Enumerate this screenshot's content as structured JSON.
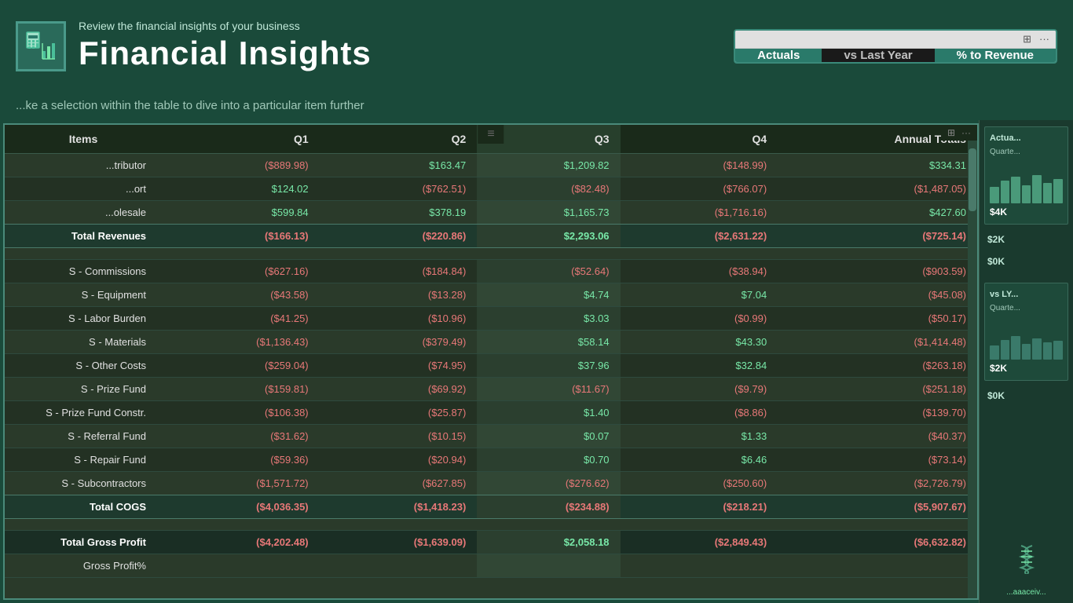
{
  "header": {
    "subtitle": "Review the financial insights of your business",
    "title": "Financial Insights"
  },
  "toggle_panel": {
    "buttons": [
      {
        "label": "Actuals",
        "active": true
      },
      {
        "label": "vs Last Year",
        "active": false
      },
      {
        "label": "% to Revenue",
        "active": false
      }
    ]
  },
  "sub_header_text": "ke a selection within the table to dive into a particular item further",
  "table": {
    "columns": [
      "Items",
      "Q1",
      "Q2",
      "Q3",
      "Q4",
      "Annual Totals"
    ],
    "rows": [
      {
        "type": "data",
        "label": "...tributor",
        "q1": "($889.98)",
        "q2": "$163.47",
        "q3": "$1,209.82",
        "q4": "($148.99)",
        "annual": "$334.31"
      },
      {
        "type": "data",
        "label": "...ort",
        "q1": "$124.02",
        "q2": "($762.51)",
        "q3": "($82.48)",
        "q4": "($766.07)",
        "annual": "($1,487.05)"
      },
      {
        "type": "data",
        "label": "...olesale",
        "q1": "$599.84",
        "q2": "$378.19",
        "q3": "$1,165.73",
        "q4": "($1,716.16)",
        "annual": "$427.60"
      },
      {
        "type": "total",
        "label": "   Total Revenues",
        "q1": "($166.13)",
        "q2": "($220.86)",
        "q3": "$2,293.06",
        "q4": "($2,631.22)",
        "annual": "($725.14)"
      },
      {
        "type": "space"
      },
      {
        "type": "data",
        "label": "S - Commissions",
        "q1": "($627.16)",
        "q2": "($184.84)",
        "q3": "($52.64)",
        "q4": "($38.94)",
        "annual": "($903.59)"
      },
      {
        "type": "data",
        "label": "S - Equipment",
        "q1": "($43.58)",
        "q2": "($13.28)",
        "q3": "$4.74",
        "q4": "$7.04",
        "annual": "($45.08)"
      },
      {
        "type": "data",
        "label": "S - Labor Burden",
        "q1": "($41.25)",
        "q2": "($10.96)",
        "q3": "$3.03",
        "q4": "($0.99)",
        "annual": "($50.17)"
      },
      {
        "type": "data",
        "label": "S - Materials",
        "q1": "($1,136.43)",
        "q2": "($379.49)",
        "q3": "$58.14",
        "q4": "$43.30",
        "annual": "($1,414.48)"
      },
      {
        "type": "data",
        "label": "S - Other Costs",
        "q1": "($259.04)",
        "q2": "($74.95)",
        "q3": "$37.96",
        "q4": "$32.84",
        "annual": "($263.18)"
      },
      {
        "type": "data",
        "label": "S - Prize Fund",
        "q1": "($159.81)",
        "q2": "($69.92)",
        "q3": "($11.67)",
        "q4": "($9.79)",
        "annual": "($251.18)"
      },
      {
        "type": "data",
        "label": "S - Prize Fund Constr.",
        "q1": "($106.38)",
        "q2": "($25.87)",
        "q3": "$1.40",
        "q4": "($8.86)",
        "annual": "($139.70)"
      },
      {
        "type": "data",
        "label": "S - Referral Fund",
        "q1": "($31.62)",
        "q2": "($10.15)",
        "q3": "$0.07",
        "q4": "$1.33",
        "annual": "($40.37)"
      },
      {
        "type": "data",
        "label": "S - Repair Fund",
        "q1": "($59.36)",
        "q2": "($20.94)",
        "q3": "$0.70",
        "q4": "$6.46",
        "annual": "($73.14)"
      },
      {
        "type": "data",
        "label": "S - Subcontractors",
        "q1": "($1,571.72)",
        "q2": "($627.85)",
        "q3": "($276.62)",
        "q4": "($250.60)",
        "annual": "($2,726.79)"
      },
      {
        "type": "total",
        "label": "   Total COGS",
        "q1": "($4,036.35)",
        "q2": "($1,418.23)",
        "q3": "($234.88)",
        "q4": "($218.21)",
        "annual": "($5,907.67)"
      },
      {
        "type": "space"
      },
      {
        "type": "bold",
        "label": "Total Gross Profit",
        "q1": "($4,202.48)",
        "q2": "($1,639.09)",
        "q3": "$2,058.18",
        "q4": "($2,849.43)",
        "annual": "($6,632.82)"
      },
      {
        "type": "data",
        "label": "Gross Profit%",
        "q1": "",
        "q2": "",
        "q3": "",
        "q4": "",
        "annual": ""
      }
    ]
  },
  "right_sidebar": {
    "sections": [
      {
        "label": "Actuals",
        "sub_label": "Quarte...",
        "value": "$4K",
        "chart_bars": [
          30,
          45,
          55,
          35,
          60,
          40,
          50
        ]
      },
      {
        "value": "$2K"
      },
      {
        "value": "$0K"
      },
      {
        "label": "vs LY...",
        "sub_label": "Quarte...",
        "value": "$2K",
        "chart_bars": [
          20,
          35,
          45,
          25,
          40,
          30,
          35
        ]
      },
      {
        "value": "$0K"
      }
    ]
  },
  "window_controls": {
    "icons": [
      "⊞",
      "···"
    ]
  },
  "colors": {
    "header_bg": "#1a4a3a",
    "table_border": "#4a8a7a",
    "accent": "#2a7a6a",
    "active_btn": "#2a7a6a",
    "inactive_btn": "#1a1a1a"
  }
}
